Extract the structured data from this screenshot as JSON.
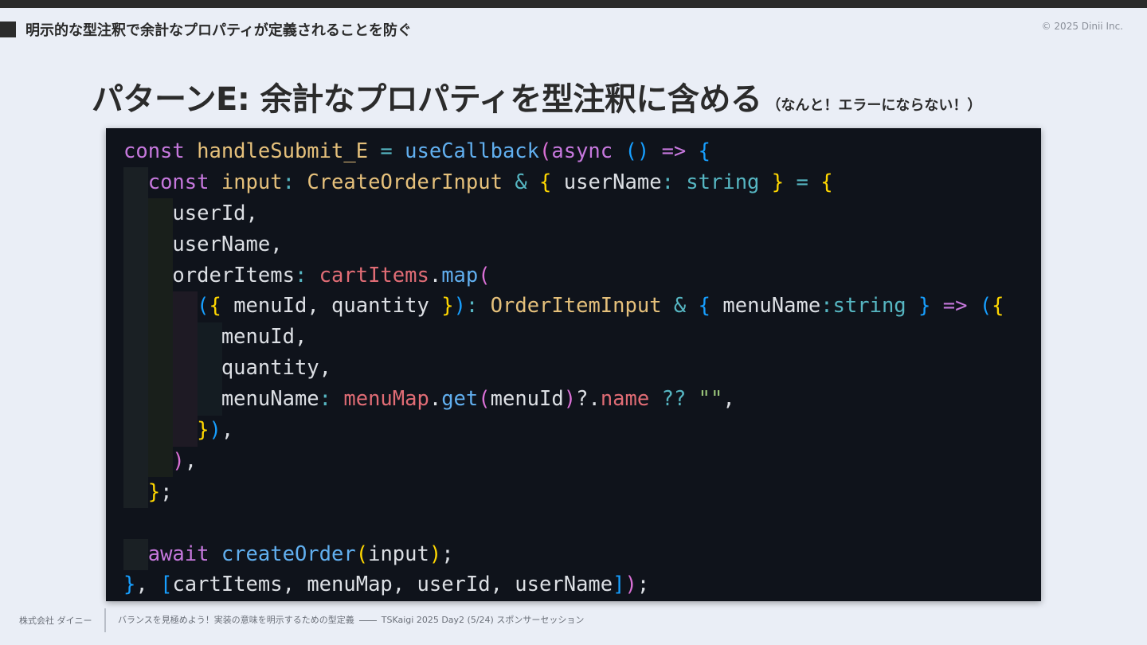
{
  "header": {
    "section_title": "明示的な型注釈で余計なプロパティが定義されることを防ぐ",
    "copyright": "© 2025 Dinii Inc."
  },
  "slide": {
    "title_main": "パターンE: 余計なプロパティを型注釈に含める",
    "title_note": "（なんと！エラーにならない！）"
  },
  "code": {
    "lines": [
      "const handleSubmit_E = useCallback(async () => {",
      "  const input: CreateOrderInput & { userName: string } = {",
      "    userId,",
      "    userName,",
      "    orderItems: cartItems.map(",
      "      ({ menuId, quantity }): OrderItemInput & { menuName:string } => ({",
      "        menuId,",
      "        quantity,",
      "        menuName: menuMap.get(menuId)?.name ?? \"\",",
      "      }),",
      "    ),",
      "  };",
      "",
      "  await createOrder(input);",
      "}, [cartItems, menuMap, userId, userName]);"
    ]
  },
  "colors": {
    "background": "#eaeef6",
    "code_background": "#0f131b",
    "keyword": "#c678dd",
    "function": "#61afef",
    "type": "#e5c07b",
    "variable": "#e06c75",
    "string": "#98c379"
  },
  "footer": {
    "company": "株式会社 ダイニー",
    "talk_title": "バランスを見極めよう！実装の意味を明示するための型定義",
    "event": "TSKaigi 2025 Day2 (5/24) スポンサーセッション"
  }
}
